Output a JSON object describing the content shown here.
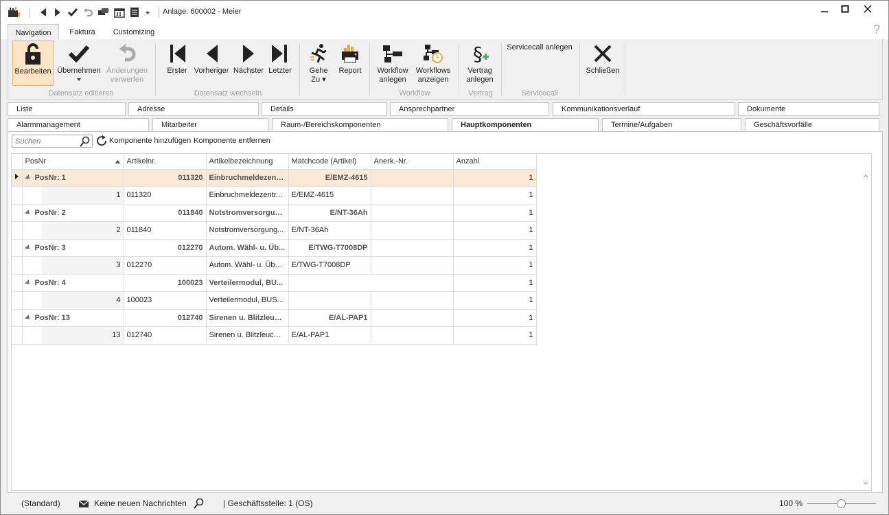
{
  "window": {
    "title": "Anlage: 600002 - Meier"
  },
  "ribbon_tabs": [
    {
      "label": "Navigation",
      "active": true
    },
    {
      "label": "Faktura",
      "active": false
    },
    {
      "label": "Customizing",
      "active": false
    }
  ],
  "ribbon": {
    "buttons": {
      "bearbeiten": "Bearbeiten",
      "uebernehmen": "Übernehmen",
      "aenderungen1": "Änderungen",
      "aenderungen2": "verwerfen",
      "erster": "Erster",
      "vorheriger": "Vorheriger",
      "naechster": "Nächster",
      "letzter": "Letzter",
      "gehe1": "Gehe",
      "gehe2": "Zu",
      "report": "Report",
      "workflow1": "Workflow",
      "workflow2": "anlegen",
      "workflows1": "Workflows",
      "workflows2": "anzeigen",
      "vertrag1": "Vertrag",
      "vertrag2": "anlegen",
      "servicecall": "Servicecall anlegen",
      "schliessen": "Schließen"
    },
    "groups": {
      "datensatz_edit": "Datensatz editieren",
      "datensatz_wechseln": "Datensatz wechseln",
      "workflow": "Workflow",
      "vertrag": "Vertrag",
      "servicecall": "Servicecall"
    }
  },
  "section_tabs_row1": [
    "Liste",
    "Adresse",
    "Details",
    "Ansprechpartner",
    "Kommunikationsverlauf",
    "Dokumente"
  ],
  "section_tabs_row2": [
    "Alarmmanagement",
    "Mitarbeiter",
    "Raum-/Bereichskomponenten",
    "Hauptkomponenten",
    "Termine/Aufgaben",
    "Geschäftsvorfälle"
  ],
  "active_section_tab": "Hauptkomponenten",
  "toolbar": {
    "search_placeholder": "Suchen",
    "add": "Komponente hinzufügen",
    "remove": "Komponente entfernen"
  },
  "grid": {
    "columns": [
      "PosNr",
      "Artikelnr.",
      "Artikelbezeichnung",
      "Matchcode (Artikel)",
      "Anerk.-Nr.",
      "Anzahl"
    ],
    "groups": [
      {
        "label": "PosNr: 1",
        "artikelnr": "011320",
        "bez": "Einbruchmeldezentr...",
        "match": "E/EMZ-4615",
        "anzahl": "1",
        "detail": {
          "pos": "1",
          "artikelnr": "011320",
          "bez": "Einbruchmeldezentr...",
          "match": "E/EMZ-4615",
          "anzahl": "1"
        }
      },
      {
        "label": "PosNr: 2",
        "artikelnr": "011840",
        "bez": "Notstromversorgun...",
        "match": "E/NT-36Ah",
        "anzahl": "1",
        "detail": {
          "pos": "2",
          "artikelnr": "011840",
          "bez": "Notstromversorgung...",
          "match": "E/NT-36Ah",
          "anzahl": "1"
        }
      },
      {
        "label": "PosNr: 3",
        "artikelnr": "012270",
        "bez": "Autom. Wähl- u. Üb...",
        "match": "E/TWG-T7008DP",
        "anzahl": "1",
        "detail": {
          "pos": "3",
          "artikelnr": "012270",
          "bez": "Autom. Wähl- u. Übe...",
          "match": "E/TWG-T7008DP",
          "anzahl": "1"
        }
      },
      {
        "label": "PosNr: 4",
        "artikelnr": "100023",
        "bez": "Verteilermodul, BU...",
        "match": "",
        "anzahl": "1",
        "detail": {
          "pos": "4",
          "artikelnr": "100023",
          "bez": "Verteilermodul, BUS...",
          "match": "",
          "anzahl": "1"
        }
      },
      {
        "label": "PosNr: 13",
        "artikelnr": "012740",
        "bez": "Sirenen u. Blitzleuch...",
        "match": "E/AL-PAP1",
        "anzahl": "1",
        "detail": {
          "pos": "13",
          "artikelnr": "012740",
          "bez": "Sirenen u. Blitzleucht...",
          "match": "E/AL-PAP1",
          "anzahl": "1"
        }
      }
    ]
  },
  "status": {
    "layout": "(Standard)",
    "messages": "Keine neuen Nachrichten",
    "branch": "| Geschäftsstelle:  1 (OS)",
    "zoom": "100 %"
  },
  "colors": {
    "selected_row": "#fbe9d7",
    "accent": "#e8b275"
  }
}
